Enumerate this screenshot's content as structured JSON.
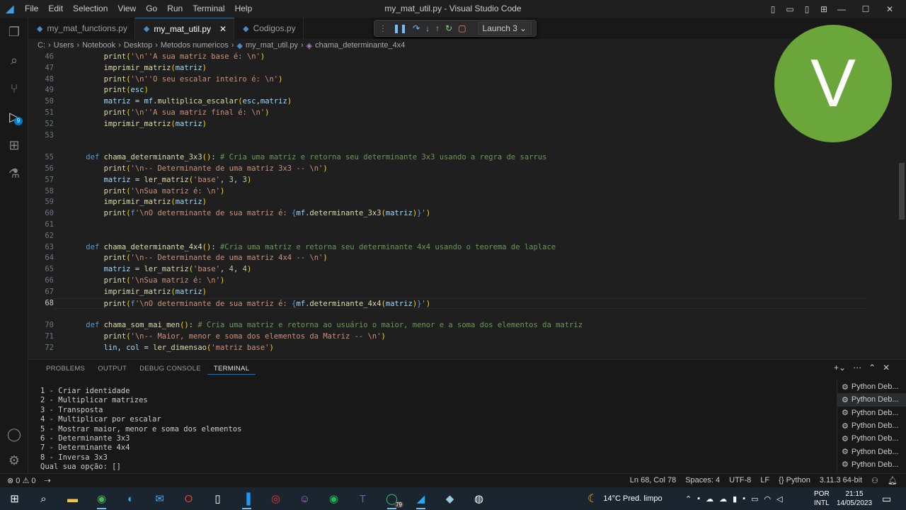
{
  "titlebar": {
    "menu": [
      "File",
      "Edit",
      "Selection",
      "View",
      "Go",
      "Run",
      "Terminal",
      "Help"
    ],
    "window_title": "my_mat_util.py - Visual Studio Code"
  },
  "activity": {
    "debug_badge": "9"
  },
  "tabs": [
    {
      "label": "my_mat_functions.py"
    },
    {
      "label": "my_mat_util.py"
    },
    {
      "label": "Codigos.py"
    }
  ],
  "debug": {
    "launch": "Launch 3"
  },
  "breadcrumb": [
    "C:",
    "Users",
    "Notebook",
    "Desktop",
    "Metodos numericos",
    "my_mat_util.py",
    "chama_determinante_4x4"
  ],
  "avatar_letter": "V",
  "panel": {
    "tabs": [
      "PROBLEMS",
      "OUTPUT",
      "DEBUG CONSOLE",
      "TERMINAL"
    ],
    "terminal_lines": [
      "1 - Criar identidade",
      "2 - Multiplicar matrizes",
      "3 - Transposta",
      "4 - Multiplicar por escalar",
      "5 - Mostrar maior, menor e soma dos elementos",
      "6 - Determinante 3x3",
      "7 - Determinante 4x4",
      "8 - Inversa 3x3",
      "Qual sua opção: []"
    ],
    "terminal_instances": [
      "Python Deb...",
      "Python Deb...",
      "Python Deb...",
      "Python Deb...",
      "Python Deb...",
      "Python Deb...",
      "Python Deb..."
    ]
  },
  "statusbar": {
    "errors": "0",
    "warnings": "0",
    "position": "Ln 68, Col 78",
    "spaces": "Spaces: 4",
    "encoding": "UTF-8",
    "eol": "LF",
    "language": "Python",
    "interpreter": "3.11.3 64-bit"
  },
  "taskbar": {
    "weather": "14°C  Pred. limpo",
    "lang1": "POR",
    "lang2": "INTL",
    "time": "21:15",
    "date": "14/05/2023",
    "whatsapp_badge": "79"
  }
}
